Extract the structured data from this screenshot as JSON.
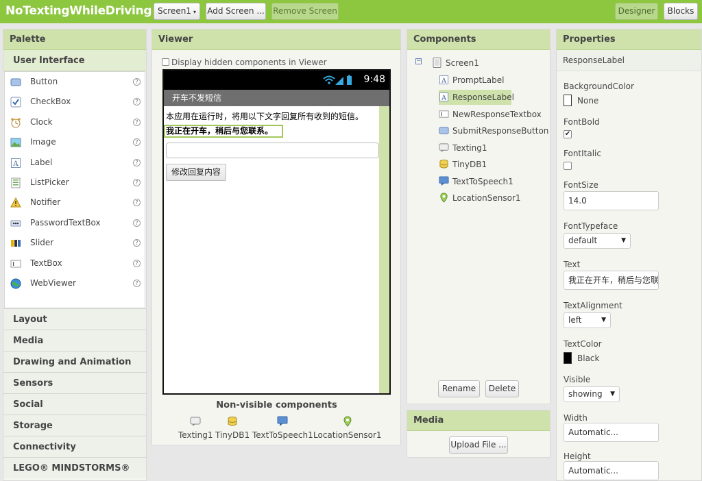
{
  "app": {
    "title": "NoTextingWhileDriving",
    "screen_select": "Screen1",
    "add_screen": "Add Screen ...",
    "remove_screen": "Remove Screen",
    "designer": "Designer",
    "blocks": "Blocks"
  },
  "palette": {
    "header": "Palette",
    "section": "User Interface",
    "items": [
      {
        "label": "Button",
        "icon": "button-icon"
      },
      {
        "label": "CheckBox",
        "icon": "checkbox-icon"
      },
      {
        "label": "Clock",
        "icon": "clock-icon"
      },
      {
        "label": "Image",
        "icon": "image-icon"
      },
      {
        "label": "Label",
        "icon": "label-icon"
      },
      {
        "label": "ListPicker",
        "icon": "listpicker-icon"
      },
      {
        "label": "Notifier",
        "icon": "notifier-icon"
      },
      {
        "label": "PasswordTextBox",
        "icon": "password-icon"
      },
      {
        "label": "Slider",
        "icon": "slider-icon"
      },
      {
        "label": "TextBox",
        "icon": "textbox-icon"
      },
      {
        "label": "WebViewer",
        "icon": "webviewer-icon"
      }
    ],
    "help_glyph": "?",
    "categories": [
      "Layout",
      "Media",
      "Drawing and Animation",
      "Sensors",
      "Social",
      "Storage",
      "Connectivity",
      "LEGO® MINDSTORMS®"
    ]
  },
  "viewer": {
    "header": "Viewer",
    "hidden_toggle": "Display hidden components in Viewer",
    "phone": {
      "time": "9:48",
      "title": "开车不发短信",
      "prompt": "本应用在运行时，将用以下文字回复所有收到的短信。",
      "response": "我正在开车，稍后与您联系。",
      "button": "修改回复内容"
    },
    "nonvisible_title": "Non-visible components",
    "nonvisible": [
      "Texting1",
      "TinyDB1",
      "TextToSpeech1",
      "LocationSensor1"
    ]
  },
  "components": {
    "header": "Components",
    "collapse_glyph": "−",
    "root": "Screen1",
    "children": [
      {
        "label": "PromptLabel",
        "icon": "label-icon"
      },
      {
        "label": "ResponseLabel",
        "icon": "label-icon"
      },
      {
        "label": "NewResponseTextbox",
        "icon": "textbox-icon"
      },
      {
        "label": "SubmitResponseButton",
        "icon": "button-icon"
      },
      {
        "label": "Texting1",
        "icon": "texting-icon"
      },
      {
        "label": "TinyDB1",
        "icon": "tinydb-icon"
      },
      {
        "label": "TextToSpeech1",
        "icon": "tts-icon"
      },
      {
        "label": "LocationSensor1",
        "icon": "location-icon"
      }
    ],
    "rename": "Rename",
    "delete": "Delete"
  },
  "media": {
    "header": "Media",
    "upload": "Upload File ..."
  },
  "properties": {
    "header": "Properties",
    "component": "ResponseLabel",
    "background_color_label": "BackgroundColor",
    "background_color_value": "None",
    "fontbold_label": "FontBold",
    "fontbold_checked": true,
    "check_glyph": "✔",
    "fontitalic_label": "FontItalic",
    "fontitalic_checked": false,
    "fontsize_label": "FontSize",
    "fontsize_value": "14.0",
    "fonttypeface_label": "FontTypeface",
    "fonttypeface_value": "default",
    "text_label": "Text",
    "text_value": "我正在开车，稍后与您联系。",
    "textalignment_label": "TextAlignment",
    "textalignment_value": "left",
    "textcolor_label": "TextColor",
    "textcolor_value": "Black",
    "visible_label": "Visible",
    "visible_value": "showing",
    "width_label": "Width",
    "width_value": "Automatic...",
    "height_label": "Height",
    "height_value": "Automatic..."
  },
  "colors": {
    "brand_green": "#8dc63f",
    "panel_header": "#cfe2ac",
    "selection": "#cfe2ac"
  }
}
